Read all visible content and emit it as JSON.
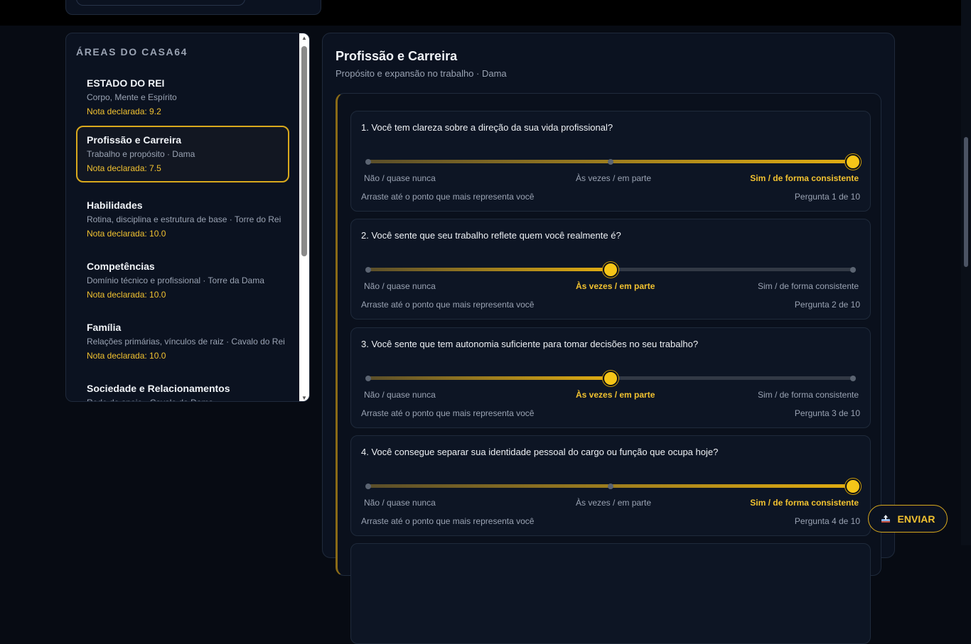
{
  "sidebar": {
    "title": "ÁREAS DO CASA64",
    "items": [
      {
        "name": "ESTADO DO REI",
        "desc": "Corpo, Mente e Espírito",
        "score": "Nota declarada: 9.2"
      },
      {
        "name": "Profissão e Carreira",
        "desc": "Trabalho e propósito · Dama",
        "score": "Nota declarada: 7.5"
      },
      {
        "name": "Habilidades",
        "desc": "Rotina, disciplina e estrutura de base · Torre do Rei",
        "score": "Nota declarada: 10.0"
      },
      {
        "name": "Competências",
        "desc": "Domínio técnico e profissional · Torre da Dama",
        "score": "Nota declarada: 10.0"
      },
      {
        "name": "Família",
        "desc": "Relações primárias, vínculos de raiz · Cavalo do Rei",
        "score": "Nota declarada: 10.0"
      },
      {
        "name": "Sociedade e Relacionamentos",
        "desc": "Rede de apoio · Cavalo da Dama",
        "score": ""
      }
    ]
  },
  "main": {
    "title": "Profissão e Carreira",
    "subtitle": "Propósito e expansão no trabalho · Dama"
  },
  "scale": {
    "low": "Não / quase nunca",
    "mid": "Às vezes / em parte",
    "high": "Sim / de forma consistente",
    "hint": "Arraste até o ponto que mais representa você"
  },
  "questions": [
    {
      "text": "1. Você tem clareza sobre a direção da sua vida profissional?",
      "value": 1.0,
      "counter": "Pergunta 1 de 10"
    },
    {
      "text": "2. Você sente que seu trabalho reflete quem você realmente é?",
      "value": 0.5,
      "counter": "Pergunta 2 de 10"
    },
    {
      "text": "3. Você sente que tem autonomia suficiente para tomar decisões no seu trabalho?",
      "value": 0.5,
      "counter": "Pergunta 3 de 10"
    },
    {
      "text": "4. Você consegue separar sua identidade pessoal do cargo ou função que ocupa hoje?",
      "value": 1.0,
      "counter": "Pergunta 4 de 10"
    }
  ],
  "send_button": {
    "label": "ENVIAR",
    "icon": "send-tray-icon"
  },
  "colors": {
    "accent": "#f2c230",
    "background": "#070b13",
    "card": "#0d1524"
  }
}
